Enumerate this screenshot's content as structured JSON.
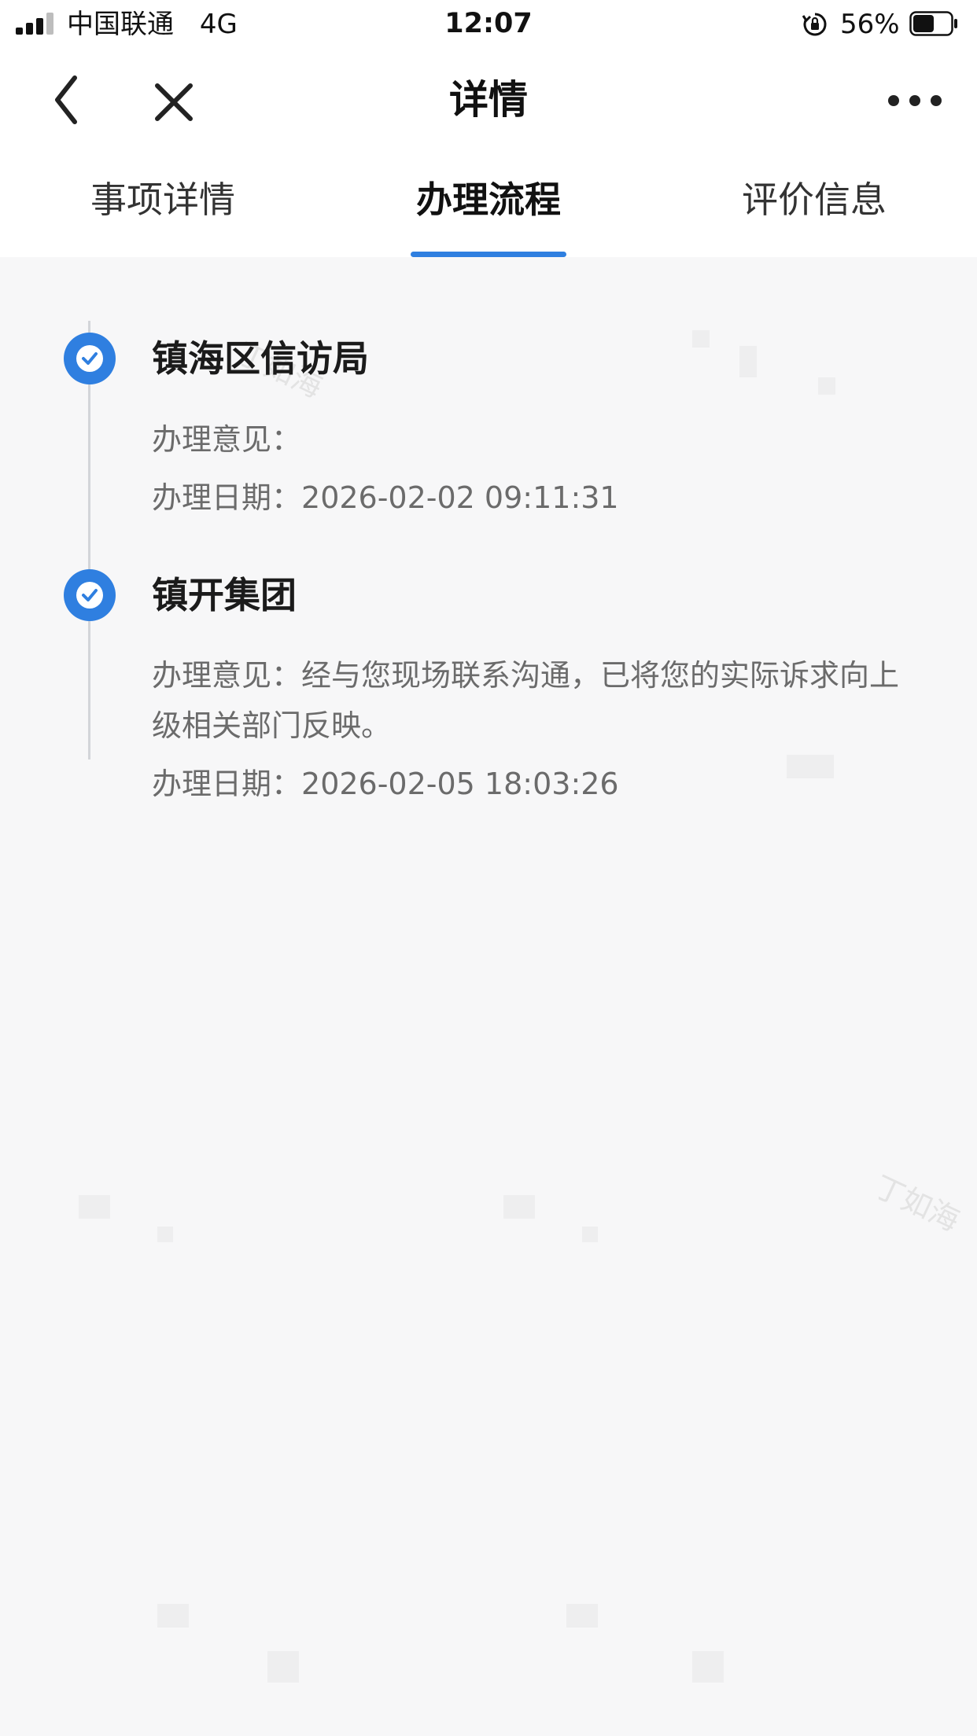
{
  "status_bar": {
    "carrier": "中国联通",
    "network": "4G",
    "time": "12:07",
    "battery_percent": "56%",
    "battery_level": 0.56,
    "signal_bars_active": 3,
    "signal_bars_total": 4
  },
  "nav": {
    "title": "详情"
  },
  "tabs": [
    {
      "label": "事项详情",
      "active": false
    },
    {
      "label": "办理流程",
      "active": true
    },
    {
      "label": "评价信息",
      "active": false
    }
  ],
  "timeline": [
    {
      "title": "镇海区信访局",
      "opinion_label": "办理意见：",
      "opinion": "",
      "date_label": "办理日期：",
      "date": "2026-02-02 09:11:31"
    },
    {
      "title": "镇开集团",
      "opinion_label": "办理意见：",
      "opinion": "经与您现场联系沟通，已将您的实际诉求向上级相关部门反映。",
      "date_label": "办理日期：",
      "date": "2026-02-05 18:03:26"
    }
  ],
  "colors": {
    "accent": "#2f7fe0",
    "background": "#f7f7f8",
    "header": "#ffffff",
    "timeline_line": "#d3d5d9"
  }
}
